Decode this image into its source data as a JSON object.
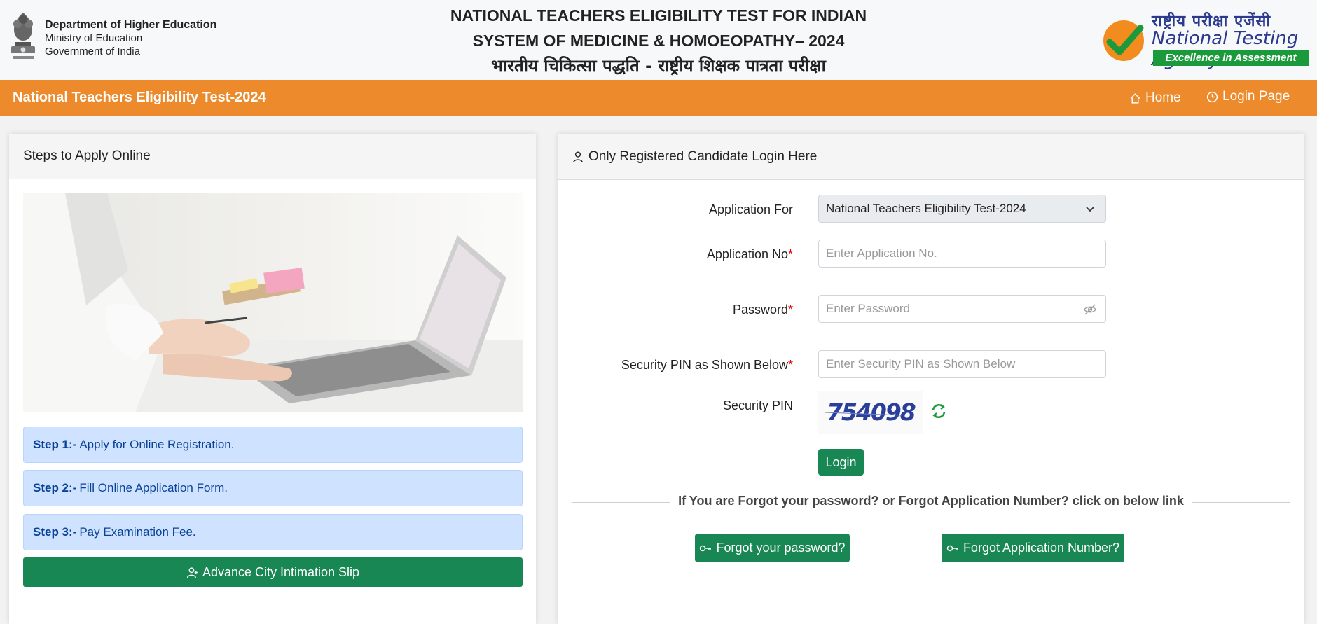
{
  "header": {
    "dept_line1": "Department of Higher Education",
    "dept_line2": "Ministry of Education",
    "dept_line3": "Government of India",
    "title_line1": "NATIONAL TEACHERS ELIGIBILITY TEST FOR INDIAN",
    "title_line2": "SYSTEM OF MEDICINE & HOMOEOPATHY– 2024",
    "title_hindi": "भारतीय चिकित्सा पद्धति - राष्ट्रीय शिक्षक पात्रता परीक्षा",
    "nta_hindi": "राष्ट्रीय परीक्षा एजेंसी",
    "nta_english": "National Testing Agency",
    "nta_tagline": "Excellence in Assessment"
  },
  "navbar": {
    "title": "National Teachers Eligibility Test-2024",
    "home_label": "Home",
    "login_label": "Login Page",
    "color": "#ec8a2c"
  },
  "left_panel": {
    "heading": "Steps to Apply Online",
    "steps": [
      {
        "prefix": "Step 1:-",
        "text": "Apply for Online Registration."
      },
      {
        "prefix": "Step 2:-",
        "text": "Fill Online Application Form."
      },
      {
        "prefix": "Step 3:-",
        "text": "Pay Examination Fee."
      }
    ],
    "city_slip_button": "Advance City Intimation Slip"
  },
  "login_panel": {
    "heading": "Only Registered Candidate Login Here",
    "application_for_label": "Application For",
    "application_for_value": "National Teachers Eligibility Test-2024",
    "application_no_label": "Application No",
    "application_no_placeholder": "Enter Application No.",
    "password_label": "Password",
    "password_placeholder": "Enter Password",
    "security_pin_input_label": "Security PIN as Shown Below",
    "security_pin_input_placeholder": "Enter Security PIN as Shown Below",
    "security_pin_label": "Security PIN",
    "captcha_text": "754098",
    "required_mark": "*",
    "login_button": "Login",
    "forgot_prompt": "If You are Forgot your password? or Forgot Application Number? click on below link",
    "forgot_password_button": "Forgot your password?",
    "forgot_appno_button": "Forgot Application Number?",
    "button_color": "#198754"
  }
}
